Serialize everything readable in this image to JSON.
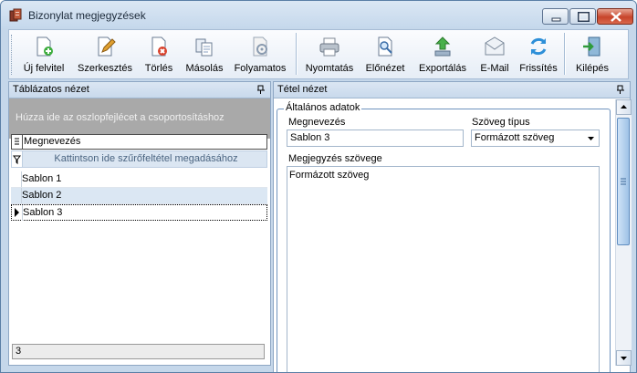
{
  "window": {
    "title": "Bizonylat megjegyzések"
  },
  "toolbar": {
    "items": [
      {
        "label": "Új felvitel",
        "icon": "new-document-icon"
      },
      {
        "label": "Szerkesztés",
        "icon": "edit-pencil-icon"
      },
      {
        "label": "Törlés",
        "icon": "delete-document-icon"
      },
      {
        "label": "Másolás",
        "icon": "copy-icon"
      },
      {
        "label": "Folyamatos",
        "icon": "continuous-icon"
      },
      {
        "label": "Nyomtatás",
        "icon": "printer-icon"
      },
      {
        "label": "Előnézet",
        "icon": "preview-icon"
      },
      {
        "label": "Exportálás",
        "icon": "export-icon"
      },
      {
        "label": "E-Mail",
        "icon": "email-icon"
      },
      {
        "label": "Frissítés",
        "icon": "refresh-icon"
      },
      {
        "label": "Kilépés",
        "icon": "exit-icon"
      }
    ]
  },
  "left_panel": {
    "title": "Táblázatos nézet",
    "group_hint": "Húzza ide az oszlopfejlécet a csoportosításhoz",
    "column_header": "Megnevezés",
    "filter_hint": "Kattintson ide szűrőfeltétel megadásához",
    "rows": [
      "Sablon 1",
      "Sablon 2",
      "Sablon 3"
    ],
    "selected_row": "Sablon 3",
    "record_count": "3"
  },
  "right_panel": {
    "title": "Tétel nézet",
    "group_title": "Általános adatok",
    "name_label": "Megnevezés",
    "name_value": "Sablon 3",
    "type_label": "Szöveg típus",
    "type_value": "Formázott szöveg",
    "text_label": "Megjegyzés szövege",
    "text_value": "Formázott szöveg"
  },
  "colors": {
    "accent": "#c5d7ea",
    "group_border": "#6e93be",
    "alt_row": "#dbe7f3"
  }
}
